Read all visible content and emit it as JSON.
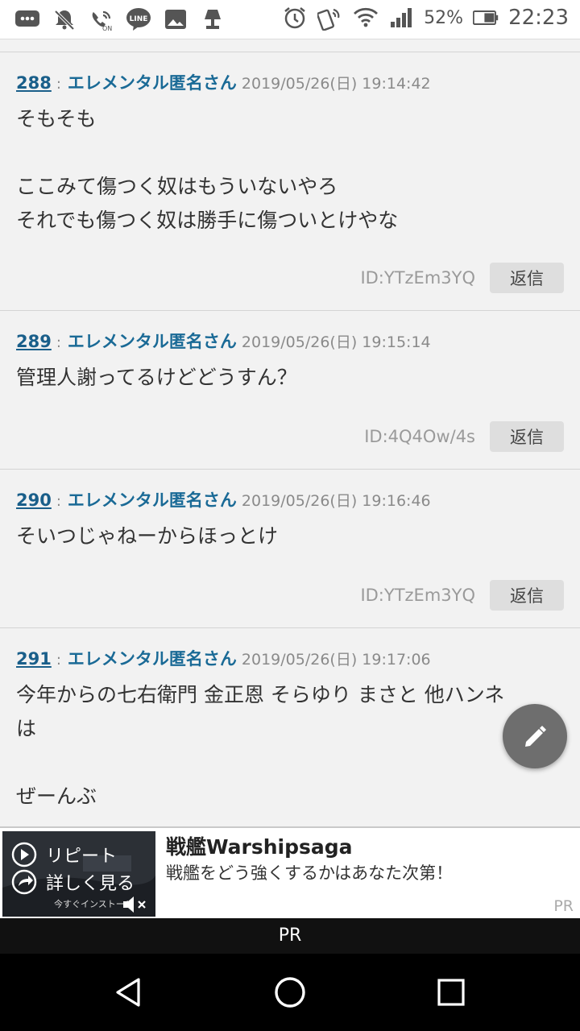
{
  "status_bar": {
    "icons": [
      "message-icon",
      "notifications-off-icon",
      "wifi-calling-icon",
      "line-app-icon",
      "gallery-icon",
      "lamp-icon",
      "alarm-icon",
      "nfc-icon",
      "wifi-icon",
      "signal-icon",
      "battery-icon"
    ],
    "wifi_calling_label": "ON",
    "line_label": "LINE",
    "battery": "52%",
    "time": "22:23"
  },
  "posts": [
    {
      "number": "288",
      "separator": ":",
      "name": "エレメンタル匿名さん",
      "date": "2019/05/26(日) 19:14:42",
      "lines": [
        "そもそも",
        "",
        "ここみて傷つく奴はもういないやろ",
        "それでも傷つく奴は勝手に傷ついとけやな"
      ],
      "id": "ID:YTzEm3YQ",
      "reply_label": "返信"
    },
    {
      "number": "289",
      "separator": ":",
      "name": "エレメンタル匿名さん",
      "date": "2019/05/26(日) 19:15:14",
      "lines": [
        "管理人謝ってるけどどうすん？"
      ],
      "id": "ID:4Q4Ow/4s",
      "reply_label": "返信"
    },
    {
      "number": "290",
      "separator": ":",
      "name": "エレメンタル匿名さん",
      "date": "2019/05/26(日) 19:16:46",
      "lines": [
        "そいつじゃねーからほっとけ"
      ],
      "id": "ID:YTzEm3YQ",
      "reply_label": "返信"
    },
    {
      "number": "291",
      "separator": ":",
      "name": "エレメンタル匿名さん",
      "date": "2019/05/26(日) 19:17:06",
      "lines": [
        "今年からの七右衛門 金正恩 そらゆり まさと 他ハンネ",
        "は",
        "",
        "ぜーんぶ"
      ]
    }
  ],
  "compose_icon": "pencil-icon",
  "ad": {
    "thumb_replay": "リピート",
    "thumb_details": "詳しく見る",
    "thumb_install": "今すぐインストール",
    "title": "戦艦Warshipsaga",
    "description": "戦艦をどう強くするかはあなた次第！",
    "pr": "PR"
  },
  "pr_strip": "PR",
  "nav": {
    "back": "back-icon",
    "home": "home-icon",
    "recents": "recents-icon"
  }
}
